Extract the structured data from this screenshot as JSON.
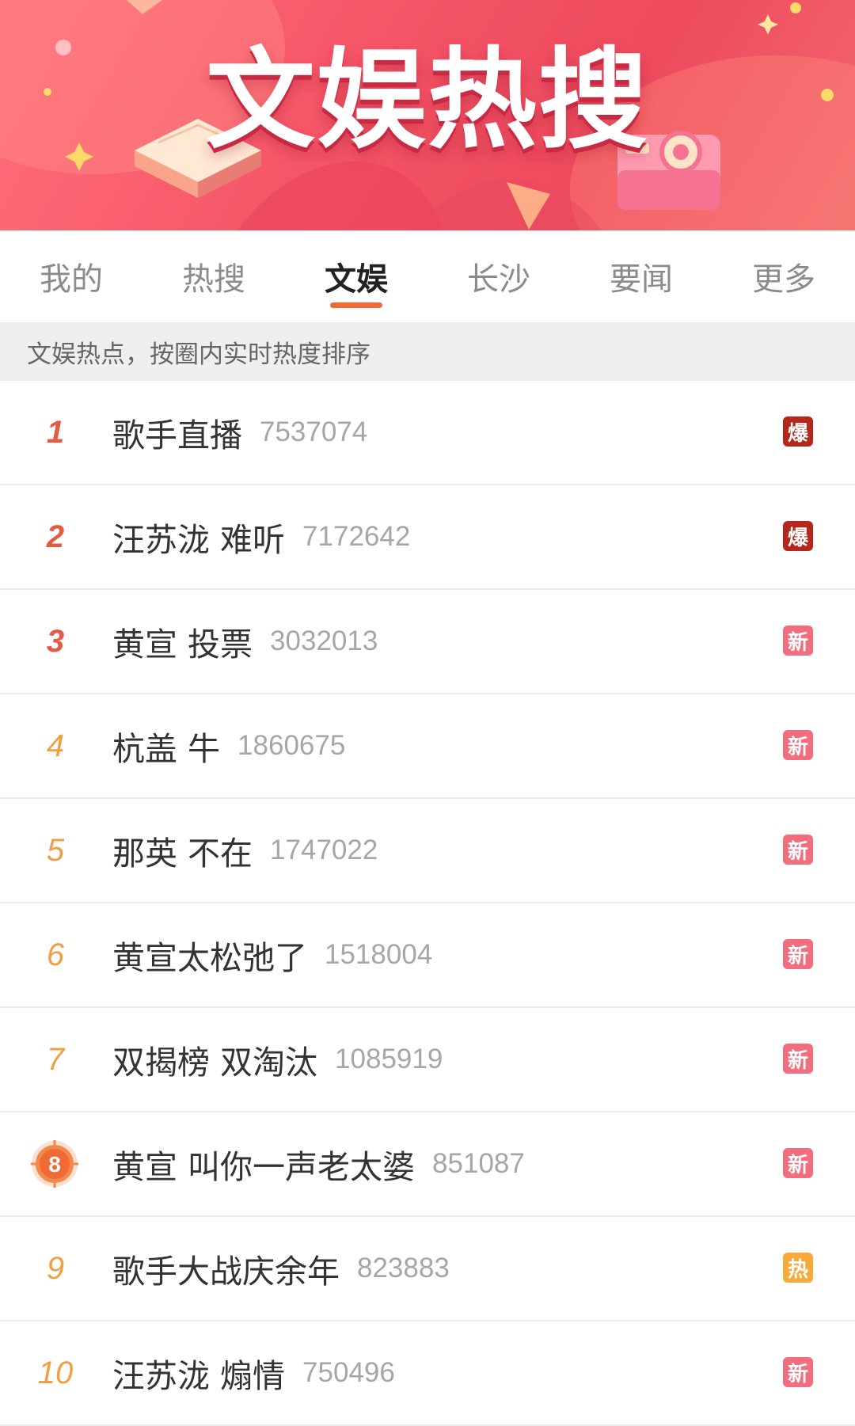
{
  "banner": {
    "title": "文娱热搜"
  },
  "tabs": [
    {
      "label": "我的",
      "active": false
    },
    {
      "label": "热搜",
      "active": false
    },
    {
      "label": "文娱",
      "active": true
    },
    {
      "label": "长沙",
      "active": false
    },
    {
      "label": "要闻",
      "active": false
    },
    {
      "label": "更多",
      "active": false
    }
  ],
  "notice": "文娱热点，按圈内实时热度排序",
  "items": [
    {
      "rank": "1",
      "title": "歌手直播",
      "count": "7537074",
      "badge": "爆"
    },
    {
      "rank": "2",
      "title": "汪苏泷 难听",
      "count": "7172642",
      "badge": "爆"
    },
    {
      "rank": "3",
      "title": "黄宣 投票",
      "count": "3032013",
      "badge": "新"
    },
    {
      "rank": "4",
      "title": "杭盖 牛",
      "count": "1860675",
      "badge": "新"
    },
    {
      "rank": "5",
      "title": "那英 不在",
      "count": "1747022",
      "badge": "新"
    },
    {
      "rank": "6",
      "title": "黄宣太松弛了",
      "count": "1518004",
      "badge": "新"
    },
    {
      "rank": "7",
      "title": "双揭榜 双淘汰",
      "count": "1085919",
      "badge": "新"
    },
    {
      "rank": "8",
      "title": "黄宣 叫你一声老太婆",
      "count": "851087",
      "badge": "新"
    },
    {
      "rank": "9",
      "title": "歌手大战庆余年",
      "count": "823883",
      "badge": "热"
    },
    {
      "rank": "10",
      "title": "汪苏泷 煽情",
      "count": "750496",
      "badge": "新"
    }
  ],
  "colors": {
    "accent": "#ef6a34",
    "rank_top": "#e55a44",
    "rank_other": "#f0a044",
    "badge_bao": "#b5271c",
    "badge_xin": "#f26d7d",
    "badge_re": "#f6aa3a"
  }
}
